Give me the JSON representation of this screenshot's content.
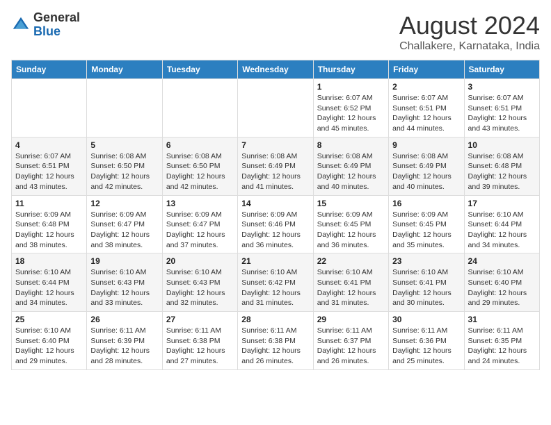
{
  "logo": {
    "line1": "General",
    "line2": "Blue"
  },
  "title": "August 2024",
  "location": "Challakere, Karnataka, India",
  "weekdays": [
    "Sunday",
    "Monday",
    "Tuesday",
    "Wednesday",
    "Thursday",
    "Friday",
    "Saturday"
  ],
  "weeks": [
    [
      {
        "day": "",
        "info": ""
      },
      {
        "day": "",
        "info": ""
      },
      {
        "day": "",
        "info": ""
      },
      {
        "day": "",
        "info": ""
      },
      {
        "day": "1",
        "info": "Sunrise: 6:07 AM\nSunset: 6:52 PM\nDaylight: 12 hours and 45 minutes."
      },
      {
        "day": "2",
        "info": "Sunrise: 6:07 AM\nSunset: 6:51 PM\nDaylight: 12 hours and 44 minutes."
      },
      {
        "day": "3",
        "info": "Sunrise: 6:07 AM\nSunset: 6:51 PM\nDaylight: 12 hours and 43 minutes."
      }
    ],
    [
      {
        "day": "4",
        "info": "Sunrise: 6:07 AM\nSunset: 6:51 PM\nDaylight: 12 hours and 43 minutes."
      },
      {
        "day": "5",
        "info": "Sunrise: 6:08 AM\nSunset: 6:50 PM\nDaylight: 12 hours and 42 minutes."
      },
      {
        "day": "6",
        "info": "Sunrise: 6:08 AM\nSunset: 6:50 PM\nDaylight: 12 hours and 42 minutes."
      },
      {
        "day": "7",
        "info": "Sunrise: 6:08 AM\nSunset: 6:49 PM\nDaylight: 12 hours and 41 minutes."
      },
      {
        "day": "8",
        "info": "Sunrise: 6:08 AM\nSunset: 6:49 PM\nDaylight: 12 hours and 40 minutes."
      },
      {
        "day": "9",
        "info": "Sunrise: 6:08 AM\nSunset: 6:49 PM\nDaylight: 12 hours and 40 minutes."
      },
      {
        "day": "10",
        "info": "Sunrise: 6:08 AM\nSunset: 6:48 PM\nDaylight: 12 hours and 39 minutes."
      }
    ],
    [
      {
        "day": "11",
        "info": "Sunrise: 6:09 AM\nSunset: 6:48 PM\nDaylight: 12 hours and 38 minutes."
      },
      {
        "day": "12",
        "info": "Sunrise: 6:09 AM\nSunset: 6:47 PM\nDaylight: 12 hours and 38 minutes."
      },
      {
        "day": "13",
        "info": "Sunrise: 6:09 AM\nSunset: 6:47 PM\nDaylight: 12 hours and 37 minutes."
      },
      {
        "day": "14",
        "info": "Sunrise: 6:09 AM\nSunset: 6:46 PM\nDaylight: 12 hours and 36 minutes."
      },
      {
        "day": "15",
        "info": "Sunrise: 6:09 AM\nSunset: 6:45 PM\nDaylight: 12 hours and 36 minutes."
      },
      {
        "day": "16",
        "info": "Sunrise: 6:09 AM\nSunset: 6:45 PM\nDaylight: 12 hours and 35 minutes."
      },
      {
        "day": "17",
        "info": "Sunrise: 6:10 AM\nSunset: 6:44 PM\nDaylight: 12 hours and 34 minutes."
      }
    ],
    [
      {
        "day": "18",
        "info": "Sunrise: 6:10 AM\nSunset: 6:44 PM\nDaylight: 12 hours and 34 minutes."
      },
      {
        "day": "19",
        "info": "Sunrise: 6:10 AM\nSunset: 6:43 PM\nDaylight: 12 hours and 33 minutes."
      },
      {
        "day": "20",
        "info": "Sunrise: 6:10 AM\nSunset: 6:43 PM\nDaylight: 12 hours and 32 minutes."
      },
      {
        "day": "21",
        "info": "Sunrise: 6:10 AM\nSunset: 6:42 PM\nDaylight: 12 hours and 31 minutes."
      },
      {
        "day": "22",
        "info": "Sunrise: 6:10 AM\nSunset: 6:41 PM\nDaylight: 12 hours and 31 minutes."
      },
      {
        "day": "23",
        "info": "Sunrise: 6:10 AM\nSunset: 6:41 PM\nDaylight: 12 hours and 30 minutes."
      },
      {
        "day": "24",
        "info": "Sunrise: 6:10 AM\nSunset: 6:40 PM\nDaylight: 12 hours and 29 minutes."
      }
    ],
    [
      {
        "day": "25",
        "info": "Sunrise: 6:10 AM\nSunset: 6:40 PM\nDaylight: 12 hours and 29 minutes."
      },
      {
        "day": "26",
        "info": "Sunrise: 6:11 AM\nSunset: 6:39 PM\nDaylight: 12 hours and 28 minutes."
      },
      {
        "day": "27",
        "info": "Sunrise: 6:11 AM\nSunset: 6:38 PM\nDaylight: 12 hours and 27 minutes."
      },
      {
        "day": "28",
        "info": "Sunrise: 6:11 AM\nSunset: 6:38 PM\nDaylight: 12 hours and 26 minutes."
      },
      {
        "day": "29",
        "info": "Sunrise: 6:11 AM\nSunset: 6:37 PM\nDaylight: 12 hours and 26 minutes."
      },
      {
        "day": "30",
        "info": "Sunrise: 6:11 AM\nSunset: 6:36 PM\nDaylight: 12 hours and 25 minutes."
      },
      {
        "day": "31",
        "info": "Sunrise: 6:11 AM\nSunset: 6:35 PM\nDaylight: 12 hours and 24 minutes."
      }
    ]
  ]
}
